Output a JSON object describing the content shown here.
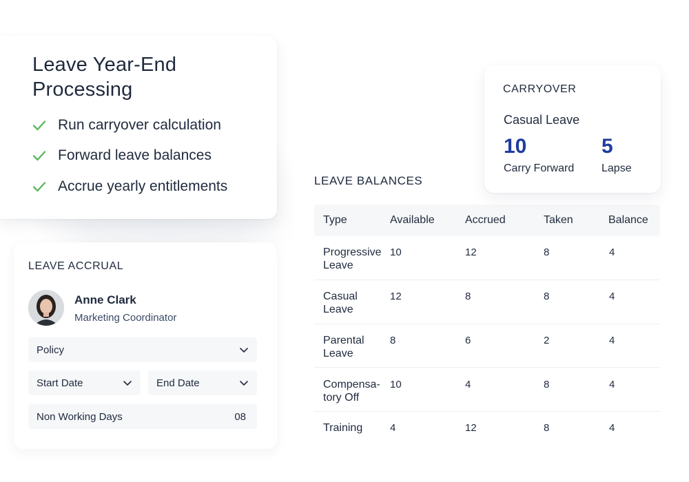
{
  "process": {
    "title": "Leave Year-End Processing",
    "tasks": [
      {
        "label": "Run carryover calculation",
        "icon": "check-icon"
      },
      {
        "label": "Forward leave balances",
        "icon": "check-icon"
      },
      {
        "label": "Accrue yearly entitlements",
        "icon": "check-icon"
      }
    ]
  },
  "accrual": {
    "section_title": "LEAVE ACCRUAL",
    "person": {
      "name": "Anne Clark",
      "role": "Marketing Coordinator"
    },
    "policy_label": "Policy",
    "start_date_label": "Start Date",
    "end_date_label": "End Date",
    "non_working_days_label": "Non Working Days",
    "non_working_days_value": "08"
  },
  "carryover": {
    "section_title": "CARRYOVER",
    "leave_type": "Casual Leave",
    "carry_forward_value": "10",
    "carry_forward_label": "Carry Forward",
    "lapse_value": "5",
    "lapse_label": "Lapse"
  },
  "balances": {
    "section_title": "LEAVE BALANCES",
    "columns": [
      "Type",
      "Available",
      "Accrued",
      "Taken",
      "Balance"
    ],
    "rows": [
      {
        "type": "Progressive Leave",
        "available": "10",
        "accrued": "12",
        "taken": "8",
        "balance": "4"
      },
      {
        "type": "Casual Leave",
        "available": "12",
        "accrued": "8",
        "taken": "8",
        "balance": "4"
      },
      {
        "type": "Parental Leave",
        "available": "8",
        "accrued": "6",
        "taken": "2",
        "balance": "4"
      },
      {
        "type": "Compensa-tory Off",
        "available": "10",
        "accrued": "4",
        "taken": "8",
        "balance": "4"
      },
      {
        "type": "Training",
        "available": "4",
        "accrued": "12",
        "taken": "8",
        "balance": "4"
      }
    ]
  },
  "colors": {
    "accent_number": "#1f3d9e",
    "check_green": "#5cb85c",
    "text_dark": "#1f2a3d",
    "field_bg": "#f6f7f9"
  }
}
